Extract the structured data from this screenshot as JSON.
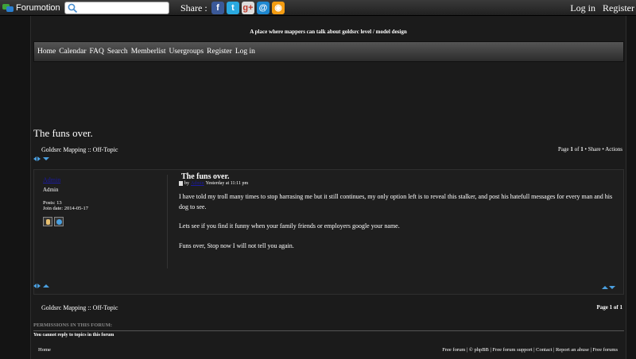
{
  "topbar": {
    "brand": "Forumotion",
    "search": {
      "value": "",
      "placeholder": ""
    },
    "share_label": "Share :",
    "share_icons": [
      {
        "name": "facebook-icon",
        "glyph": "f",
        "color": "#3b5998"
      },
      {
        "name": "twitter-icon",
        "glyph": "t",
        "color": "#2aa9e0"
      },
      {
        "name": "google-plus-icon",
        "glyph": "g+",
        "color": "#dcdcdc"
      },
      {
        "name": "email-icon",
        "glyph": "@",
        "color": "#1e88d0"
      },
      {
        "name": "rss-icon",
        "glyph": "◉",
        "color": "#f39c12"
      }
    ],
    "login": "Log in",
    "register": "Register"
  },
  "header": {
    "tagline": "A place where mappers can talk about goldsrc level / model design"
  },
  "nav": {
    "items": [
      "Home",
      "Calendar",
      "FAQ",
      "Search",
      "Memberlist",
      "Usergroups",
      "Register",
      "Log in"
    ]
  },
  "topic": {
    "title": "The funs over.",
    "breadcrumb": "Goldsrc Mapping :: Off-Topic",
    "page_info": {
      "prefix": "Page ",
      "current": "1",
      "of": " of ",
      "total": "1",
      "sep": " • ",
      "share": "Share",
      "actions": "Actions"
    }
  },
  "post": {
    "author": "Admin",
    "role": "Admin",
    "posts": "Posts: 13",
    "join_date": "Join date: 2014-05-17",
    "title": "The funs over.",
    "meta": {
      "by": "by",
      "author": "Admin",
      "time": "Yesterday at 11:11 pm"
    },
    "body": [
      "I have told my troll many times to stop harrasing me but it still continues, my only option left is to reveal this stalker, and post his hatefull messages for every man and his dog to see.",
      "Lets see if you find it funny when your family friends or employers google your name.",
      "Funs over, Stop now I will not tell you again."
    ]
  },
  "bottom": {
    "breadcrumb": "Goldsrc Mapping :: Off-Topic",
    "page_info": "Page 1 of 1"
  },
  "permissions": {
    "heading": "PERMISSIONS IN THIS FORUM:",
    "text": "You cannot reply to topics in this forum"
  },
  "footer": {
    "left": "Home",
    "links": [
      "Free forum",
      "© phpBB",
      "Free forum support",
      "Contact",
      "Report an abuse",
      "Free forums"
    ]
  }
}
